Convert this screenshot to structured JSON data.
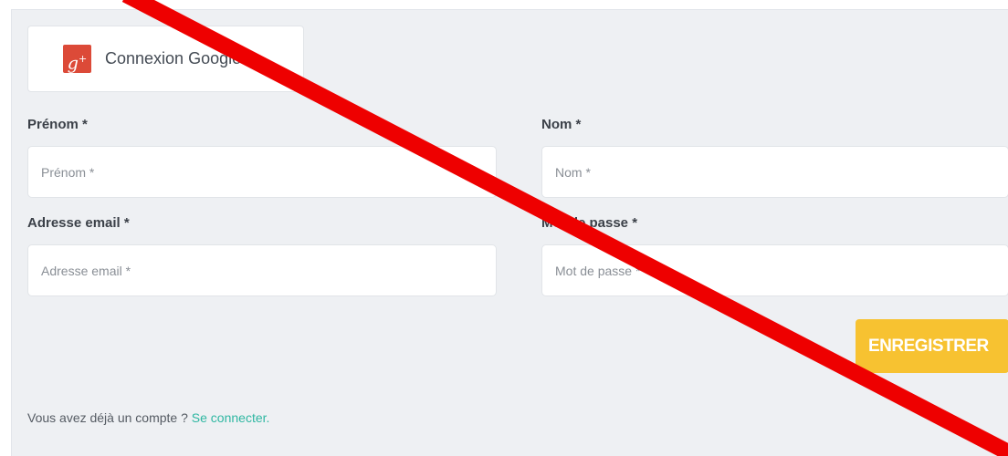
{
  "google": {
    "label": "Connexion Google",
    "icon": "google-plus-icon"
  },
  "form": {
    "first_name": {
      "label": "Prénom *",
      "placeholder": "Prénom *"
    },
    "last_name": {
      "label": "Nom *",
      "placeholder": "Nom *"
    },
    "email": {
      "label": "Adresse email *",
      "placeholder": "Adresse email *"
    },
    "password": {
      "label": "Mot de passe *",
      "placeholder": "Mot de passe *"
    },
    "submit_label": "ENREGISTRER"
  },
  "account": {
    "prompt": "Vous avez déjà un compte ? ",
    "link_label": "Se connecter."
  },
  "colors": {
    "accent": "#f7c231",
    "link": "#2fb7a2",
    "google_red": "#dc4a38",
    "slash": "#ee0000"
  }
}
